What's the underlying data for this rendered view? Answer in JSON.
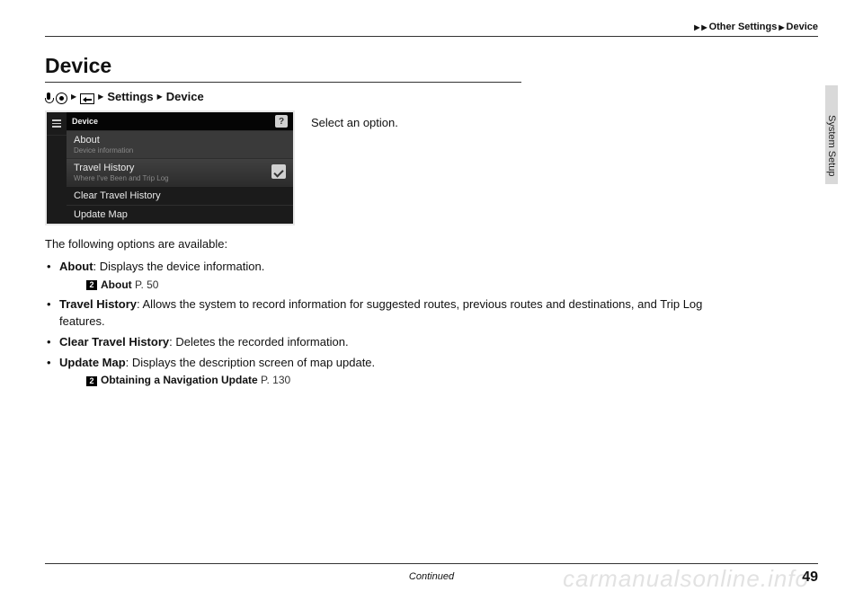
{
  "breadcrumb": {
    "a": "Other Settings",
    "b": "Device"
  },
  "side_label": "System Setup",
  "title": "Device",
  "navpath": {
    "settings": "Settings",
    "device": "Device"
  },
  "screenshot": {
    "header": "Device",
    "items": [
      {
        "title": "About",
        "sub": "Device information"
      },
      {
        "title": "Travel History",
        "sub": "Where I've Been and Trip Log"
      },
      {
        "title": "Clear Travel History",
        "sub": ""
      },
      {
        "title": "Update Map",
        "sub": ""
      }
    ],
    "help": "?"
  },
  "instruction": "Select an option.",
  "intro": "The following options are available:",
  "options": {
    "about": {
      "name": "About",
      "desc": ": Displays the device information."
    },
    "about_ref": {
      "label": "About",
      "page": "P. 50"
    },
    "travel": {
      "name": "Travel History",
      "desc": ": Allows the system to record information for suggested routes, previous routes and destinations, and Trip Log features."
    },
    "clear": {
      "name": "Clear Travel History",
      "desc": ": Deletes the recorded information."
    },
    "update": {
      "name": "Update Map",
      "desc": ": Displays the description screen of map update."
    },
    "update_ref": {
      "label": "Obtaining a Navigation Update",
      "page": "P. 130"
    }
  },
  "ref_icon": "2",
  "continued": "Continued",
  "page_number": "49",
  "watermark": "carmanualsonline.info"
}
